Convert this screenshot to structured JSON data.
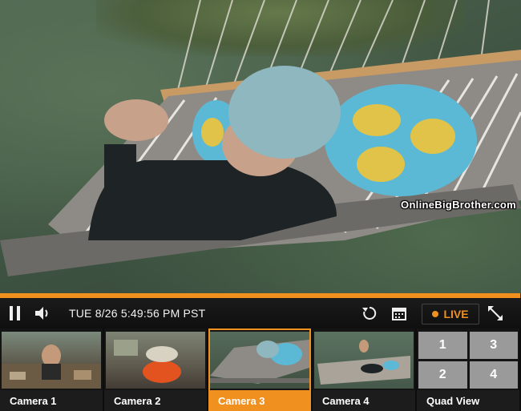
{
  "watermark": "OnlineBigBrother.com",
  "player": {
    "timestamp": "TUE 8/26 5:49:56 PM PST",
    "live_label": "LIVE",
    "progress": 0.998,
    "accent_color": "#f0901e"
  },
  "icons": {
    "pause": "pause-icon",
    "volume": "speaker-icon",
    "replay": "replay-icon",
    "calendar": "calendar-icon",
    "fullscreen": "fullscreen-icon"
  },
  "cameras": [
    {
      "label": "Camera 1",
      "active": false
    },
    {
      "label": "Camera 2",
      "active": false
    },
    {
      "label": "Camera 3",
      "active": true
    },
    {
      "label": "Camera 4",
      "active": false
    },
    {
      "label": "Quad View",
      "active": false
    }
  ],
  "quad_numbers": [
    "1",
    "3",
    "2",
    "4"
  ]
}
